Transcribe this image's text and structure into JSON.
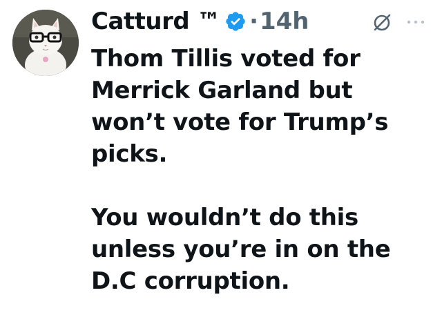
{
  "tweet": {
    "author": {
      "display_name": "Catturd ™",
      "avatar": "cat-with-glasses-avatar",
      "verified": true,
      "verified_icon": "verified-badge-icon",
      "verified_color": "#1d9bf0"
    },
    "separator": "·",
    "timestamp": "14h",
    "text": "Thom Tillis voted for Merrick Garland but won’t vote for Trump’s picks.\n\nYou wouldn’t do this unless you’re in on the D.C corruption.",
    "icons": {
      "grok": "grok-icon",
      "more": "more-options-icon"
    },
    "colors": {
      "text": "#0f1419",
      "secondary": "#536471"
    }
  }
}
